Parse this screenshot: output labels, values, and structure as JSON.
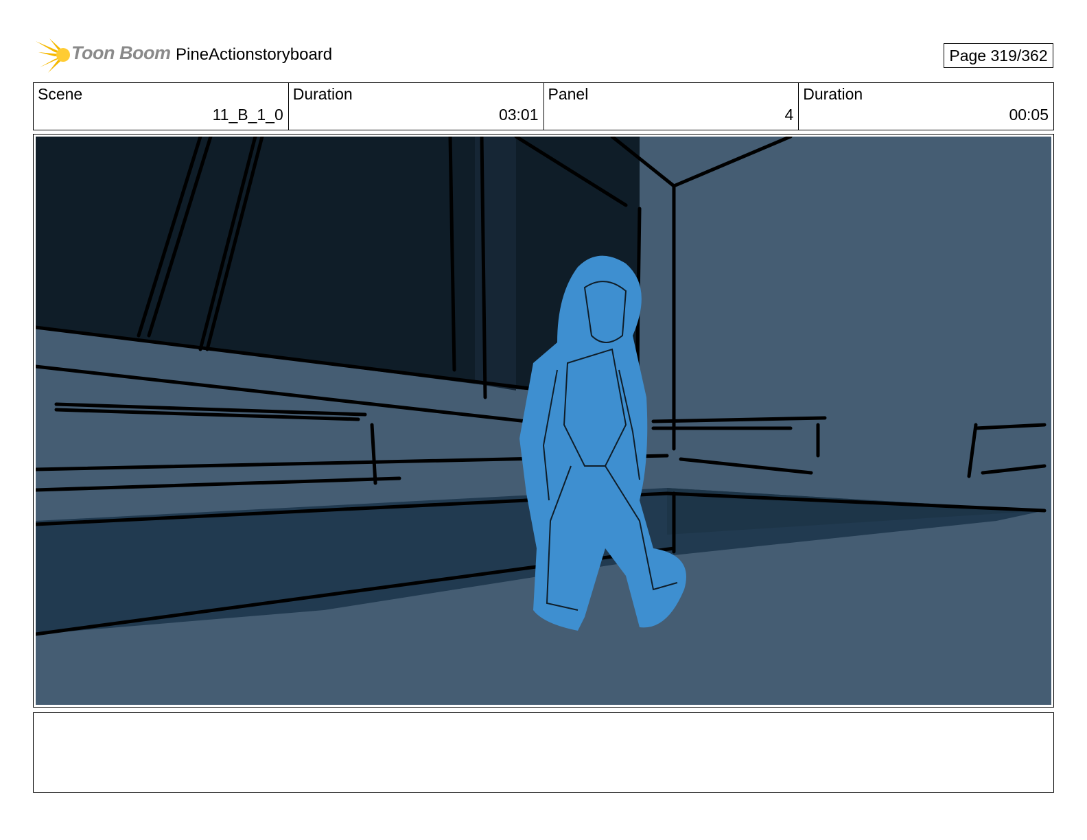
{
  "header": {
    "logo_text": "Toon Boom",
    "project_title": "PineActionstoryboard",
    "page_label": "Page 319/362"
  },
  "info": {
    "scene_label": "Scene",
    "scene_value": "11_B_1_0",
    "scene_duration_label": "Duration",
    "scene_duration_value": "03:01",
    "panel_label": "Panel",
    "panel_value": "4",
    "panel_duration_label": "Duration",
    "panel_duration_value": "00:05"
  },
  "colors": {
    "sky_dark": "#0f1d28",
    "wall_blue": "#455d73",
    "floor_shadow": "#213a50",
    "character_highlight": "#3e8fd0",
    "logo_yellow": "#f5b800"
  },
  "notes": {
    "text": ""
  }
}
